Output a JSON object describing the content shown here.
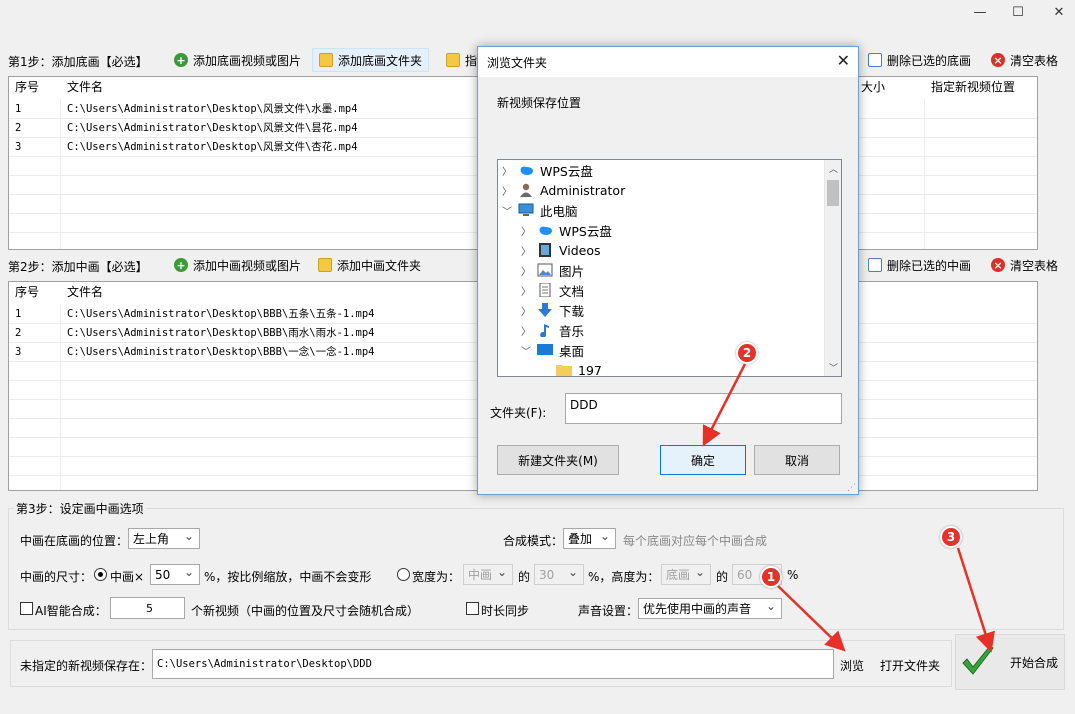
{
  "window": {
    "min": "—",
    "max": "☐",
    "close": "✕"
  },
  "step1": {
    "label": "第1步：添加底画【必选】",
    "add_media": "添加底画视频或图片",
    "add_folder": "添加底画文件夹",
    "partial_btn": "指",
    "delete_selected": "删除已选的底画",
    "clear_table": "清空表格",
    "headers": [
      "序号",
      "文件名",
      "大小",
      "指定新视频位置"
    ],
    "rows": [
      {
        "no": "1",
        "file": "C:\\Users\\Administrator\\Desktop\\风景文件\\水墨.mp4"
      },
      {
        "no": "2",
        "file": "C:\\Users\\Administrator\\Desktop\\风景文件\\昙花.mp4"
      },
      {
        "no": "3",
        "file": "C:\\Users\\Administrator\\Desktop\\风景文件\\杏花.mp4"
      }
    ]
  },
  "step2": {
    "label": "第2步：添加中画【必选】",
    "add_media": "添加中画视频或图片",
    "add_folder": "添加中画文件夹",
    "delete_selected": "删除已选的中画",
    "clear_table": "清空表格",
    "headers": [
      "序号",
      "文件名"
    ],
    "rows": [
      {
        "no": "1",
        "file": "C:\\Users\\Administrator\\Desktop\\BBB\\五条\\五条-1.mp4"
      },
      {
        "no": "2",
        "file": "C:\\Users\\Administrator\\Desktop\\BBB\\雨水\\雨水-1.mp4"
      },
      {
        "no": "3",
        "file": "C:\\Users\\Administrator\\Desktop\\BBB\\一念\\一念-1.mp4"
      }
    ]
  },
  "step3": {
    "label": "第3步：设定画中画选项",
    "position_label": "中画在底画的位置：",
    "position_value": "左上角",
    "mode_label": "合成模式：",
    "mode_value": "叠加",
    "mode_hint": "每个底画对应每个中画合成",
    "size_label": "中画的尺寸：",
    "radio1": "中画×",
    "scale_value": "50",
    "scale_suffix": "%，按比例缩放，中画不会变形",
    "radio2": "宽度为：",
    "width_ref": "中画",
    "of1": "的",
    "width_pct": "30",
    "height_label": "%，高度为：",
    "height_ref": "底画",
    "of2": "的",
    "height_pct": "60",
    "pct": "%",
    "ai_label": "AI智能合成：",
    "ai_count": "5",
    "ai_suffix": "个新视频（中画的位置及尺寸会随机合成）",
    "sync_label": "时长同步",
    "audio_label": "声音设置：",
    "audio_value": "优先使用中画的声音"
  },
  "output": {
    "label": "未指定的新视频保存在：",
    "path": "C:\\Users\\Administrator\\Desktop\\DDD",
    "browse": "浏览",
    "open_folder": "打开文件夹",
    "start": "开始合成"
  },
  "dialog": {
    "title": "浏览文件夹",
    "close": "✕",
    "prompt": "新视频保存位置",
    "tree": [
      {
        "label": "WPS云盘",
        "icon": "cloud-icon"
      },
      {
        "label": "Administrator",
        "icon": "user-icon"
      },
      {
        "label": "此电脑",
        "icon": "computer-icon"
      },
      {
        "label": "WPS云盘",
        "icon": "cloud-icon"
      },
      {
        "label": "Videos",
        "icon": "video-icon"
      },
      {
        "label": "图片",
        "icon": "picture-icon"
      },
      {
        "label": "文档",
        "icon": "document-icon"
      },
      {
        "label": "下载",
        "icon": "download-icon"
      },
      {
        "label": "音乐",
        "icon": "music-icon"
      },
      {
        "label": "桌面",
        "icon": "desktop-icon"
      },
      {
        "label": "197",
        "icon": "folder-icon"
      }
    ],
    "folder_label": "文件夹(F):",
    "folder_value": "DDD",
    "new_folder": "新建文件夹(M)",
    "ok": "确定",
    "cancel": "取消"
  },
  "badges": [
    "1",
    "2",
    "3"
  ],
  "colors": {
    "badge": "#e63028",
    "selection": "#e5f0fb",
    "accent": "#0078d7"
  }
}
